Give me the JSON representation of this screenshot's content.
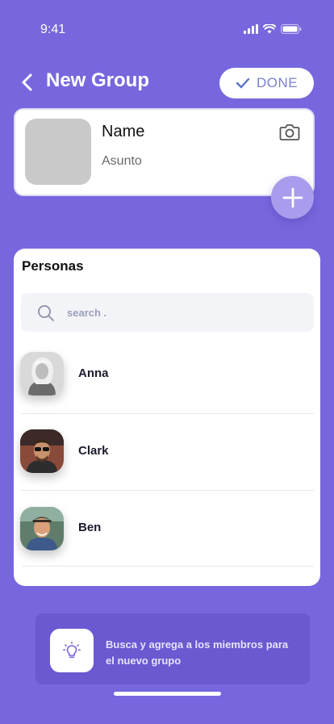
{
  "status_bar": {
    "time": "9:41"
  },
  "header": {
    "title": "New Group",
    "done_label": "DONE"
  },
  "group": {
    "name": "Name",
    "subject": "Asunto"
  },
  "people": {
    "title": "Personas",
    "search_placeholder": "search .",
    "search_value": "",
    "contacts": [
      {
        "name": "Anna"
      },
      {
        "name": "Clark"
      },
      {
        "name": "Ben"
      }
    ]
  },
  "hint": {
    "text": "Busca y agrega a los miembros para el nuevo grupo"
  },
  "icons": {
    "back": "chevron-left-icon",
    "done": "check-icon",
    "camera": "camera-icon",
    "add": "plus-icon",
    "search": "search-icon",
    "hint": "lightbulb-icon"
  },
  "colors": {
    "background": "#7767de",
    "accent": "#7b7fd0",
    "fab": "#a99cec",
    "hint_card": "#6a59d1"
  }
}
